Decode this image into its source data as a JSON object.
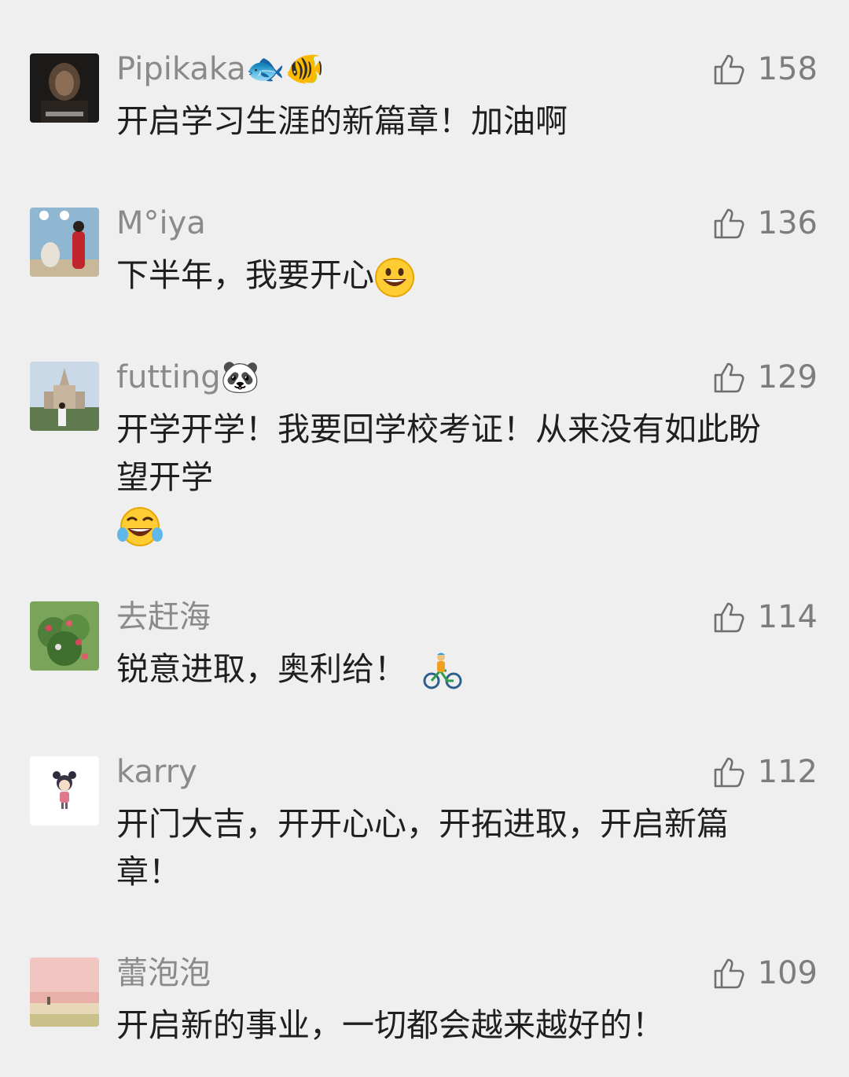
{
  "comments": [
    {
      "username": "Pipikaka🐟🐠",
      "likes": "158",
      "text": "开启学习生涯的新篇章！加油啊",
      "avatar_icon": "dark-portrait-avatar"
    },
    {
      "username": "M°iya",
      "likes": "136",
      "text": "下半年，我要开心",
      "text_emoji": "smile-emoji",
      "avatar_icon": "blue-room-photo-avatar"
    },
    {
      "username": "futting🐼",
      "likes": "129",
      "text": "开学开学！我要回学校考证！从来没有如此盼望开学",
      "text_emoji": "tears-of-joy-emoji",
      "avatar_icon": "castle-photo-avatar"
    },
    {
      "username": "去赶海",
      "likes": "114",
      "text": "锐意进取，奥利给！",
      "text_emoji": "cyclist-emoji",
      "avatar_icon": "flower-bush-avatar"
    },
    {
      "username": "karry",
      "likes": "112",
      "text": "开门大吉，开开心心，开拓进取，开启新篇章！",
      "avatar_icon": "cartoon-girl-avatar"
    },
    {
      "username": "蕾泡泡",
      "likes": "109",
      "text": "开启新的事业，一切都会越来越好的！",
      "avatar_icon": "pink-beach-avatar"
    }
  ],
  "colors": {
    "background": "#efefef",
    "username": "#8a8a8a",
    "comment_text": "#1f1f1f",
    "like": "#7d7d7d"
  }
}
